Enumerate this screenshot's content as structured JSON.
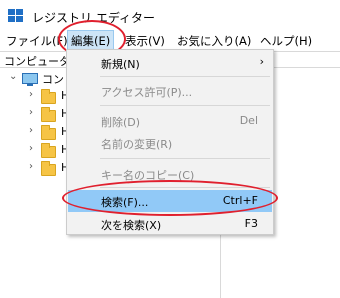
{
  "window": {
    "title": "レジストリ エディター"
  },
  "menubar": {
    "items": [
      {
        "label": "ファイル(F)"
      },
      {
        "label": "編集(E)"
      },
      {
        "label": "表示(V)"
      },
      {
        "label": "お気に入り(A)"
      },
      {
        "label": "ヘルプ(H)"
      }
    ]
  },
  "address": {
    "path": "コンピューター"
  },
  "tree": {
    "root_label": "コンピ",
    "child_label": "H"
  },
  "edit_menu": {
    "items": [
      {
        "label": "新規(N)",
        "shortcut": "",
        "disabled": false,
        "submenu": true
      },
      {
        "label": "アクセス許可(P)...",
        "shortcut": "",
        "disabled": true
      },
      {
        "label": "削除(D)",
        "shortcut": "Del",
        "disabled": true
      },
      {
        "label": "名前の変更(R)",
        "shortcut": "",
        "disabled": true
      },
      {
        "label": "キー名のコピー(C)",
        "shortcut": "",
        "disabled": true
      },
      {
        "label": "検索(F)...",
        "shortcut": "Ctrl+F",
        "disabled": false,
        "highlighted": true
      },
      {
        "label": "次を検索(X)",
        "shortcut": "F3",
        "disabled": false
      }
    ]
  },
  "colors": {
    "highlight": "#91c9f7",
    "menu_bg": "#f2f2f2",
    "annotation": "#e0202e",
    "folder": "#f6c445"
  }
}
